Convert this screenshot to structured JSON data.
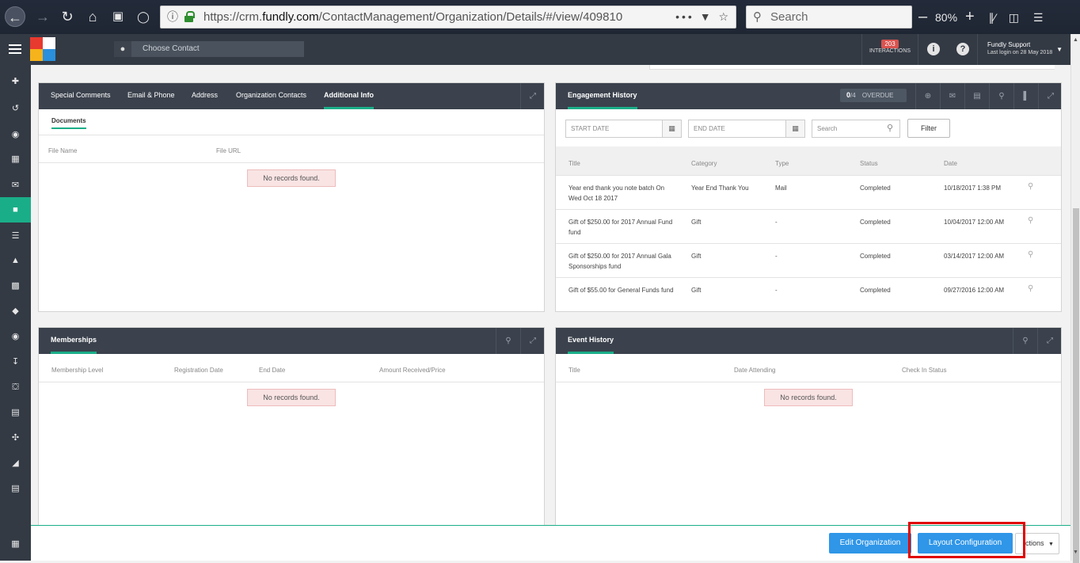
{
  "browser": {
    "url_prefix": "https://crm.",
    "url_domain": "fundly.com",
    "url_path": "/ContactManagement/Organization/Details/#/view/409810",
    "search_placeholder": "Search",
    "zoom": "80%"
  },
  "header": {
    "choose_contact_placeholder": "Choose Contact",
    "interactions_count": "203",
    "interactions_label": "INTERACTIONS",
    "user_name": "Fundly Support",
    "last_login": "Last login on 28 May 2018"
  },
  "info_panel": {
    "tabs": [
      "Special Comments",
      "Email & Phone",
      "Address",
      "Organization Contacts",
      "Additional Info"
    ],
    "active_tab": "Additional Info",
    "subtab": "Documents",
    "columns": [
      "File Name",
      "File URL"
    ],
    "empty_text": "No records found."
  },
  "engagement": {
    "title": "Engagement History",
    "overdue_count": "0",
    "overdue_total": "/4",
    "overdue_label": "OVERDUE",
    "start_date_placeholder": "START DATE",
    "end_date_placeholder": "END DATE",
    "search_placeholder": "Search",
    "filter_label": "Filter",
    "columns": [
      "Title",
      "Category",
      "Type",
      "Status",
      "Date"
    ],
    "rows": [
      {
        "title": "Year end thank you note batch On Wed Oct 18 2017",
        "category": "Year End Thank You",
        "type": "Mail",
        "status": "Completed",
        "date": "10/18/2017 1:38 PM"
      },
      {
        "title": "Gift of $250.00 for 2017 Annual Fund fund",
        "category": "Gift",
        "type": "-",
        "status": "Completed",
        "date": "10/04/2017 12:00 AM"
      },
      {
        "title": "Gift of $250.00 for 2017 Annual Gala Sponsorships fund",
        "category": "Gift",
        "type": "-",
        "status": "Completed",
        "date": "03/14/2017 12:00 AM"
      },
      {
        "title": "Gift of $55.00 for General Funds fund",
        "category": "Gift",
        "type": "-",
        "status": "Completed",
        "date": "09/27/2016 12:00 AM"
      }
    ]
  },
  "memberships": {
    "title": "Memberships",
    "columns": [
      "Membership Level",
      "Registration Date",
      "End Date",
      "Amount Received/Price"
    ],
    "empty_text": "No records found."
  },
  "events": {
    "title": "Event History",
    "columns": [
      "Title",
      "Date Attending",
      "Check In Status"
    ],
    "empty_text": "No records found."
  },
  "footer": {
    "edit_label": "Edit Organization",
    "layout_label": "Layout Configuration",
    "actions_label": "ctions"
  }
}
